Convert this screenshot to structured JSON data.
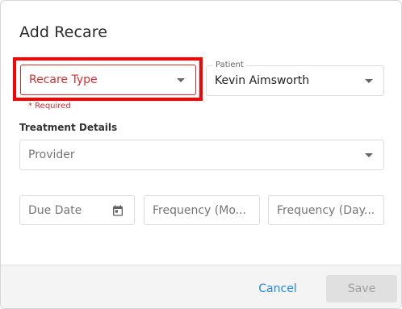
{
  "dialog": {
    "title": "Add Recare"
  },
  "recare_type": {
    "placeholder": "Recare Type",
    "required_text": "* Required"
  },
  "patient": {
    "label": "Patient",
    "value": "Kevin Aimsworth"
  },
  "treatment": {
    "section_label": "Treatment Details",
    "provider_placeholder": "Provider",
    "due_date_placeholder": "Due Date",
    "frequency_months_placeholder": "Frequency (Mo...",
    "frequency_days_placeholder": "Frequency (Day..."
  },
  "footer": {
    "cancel_label": "Cancel",
    "save_label": "Save"
  },
  "colors": {
    "error": "#d32f2f",
    "highlight": "#ff0000",
    "link": "#1e88e5"
  },
  "icons": {
    "dropdown": "chevron-down-icon",
    "calendar": "calendar-icon"
  }
}
